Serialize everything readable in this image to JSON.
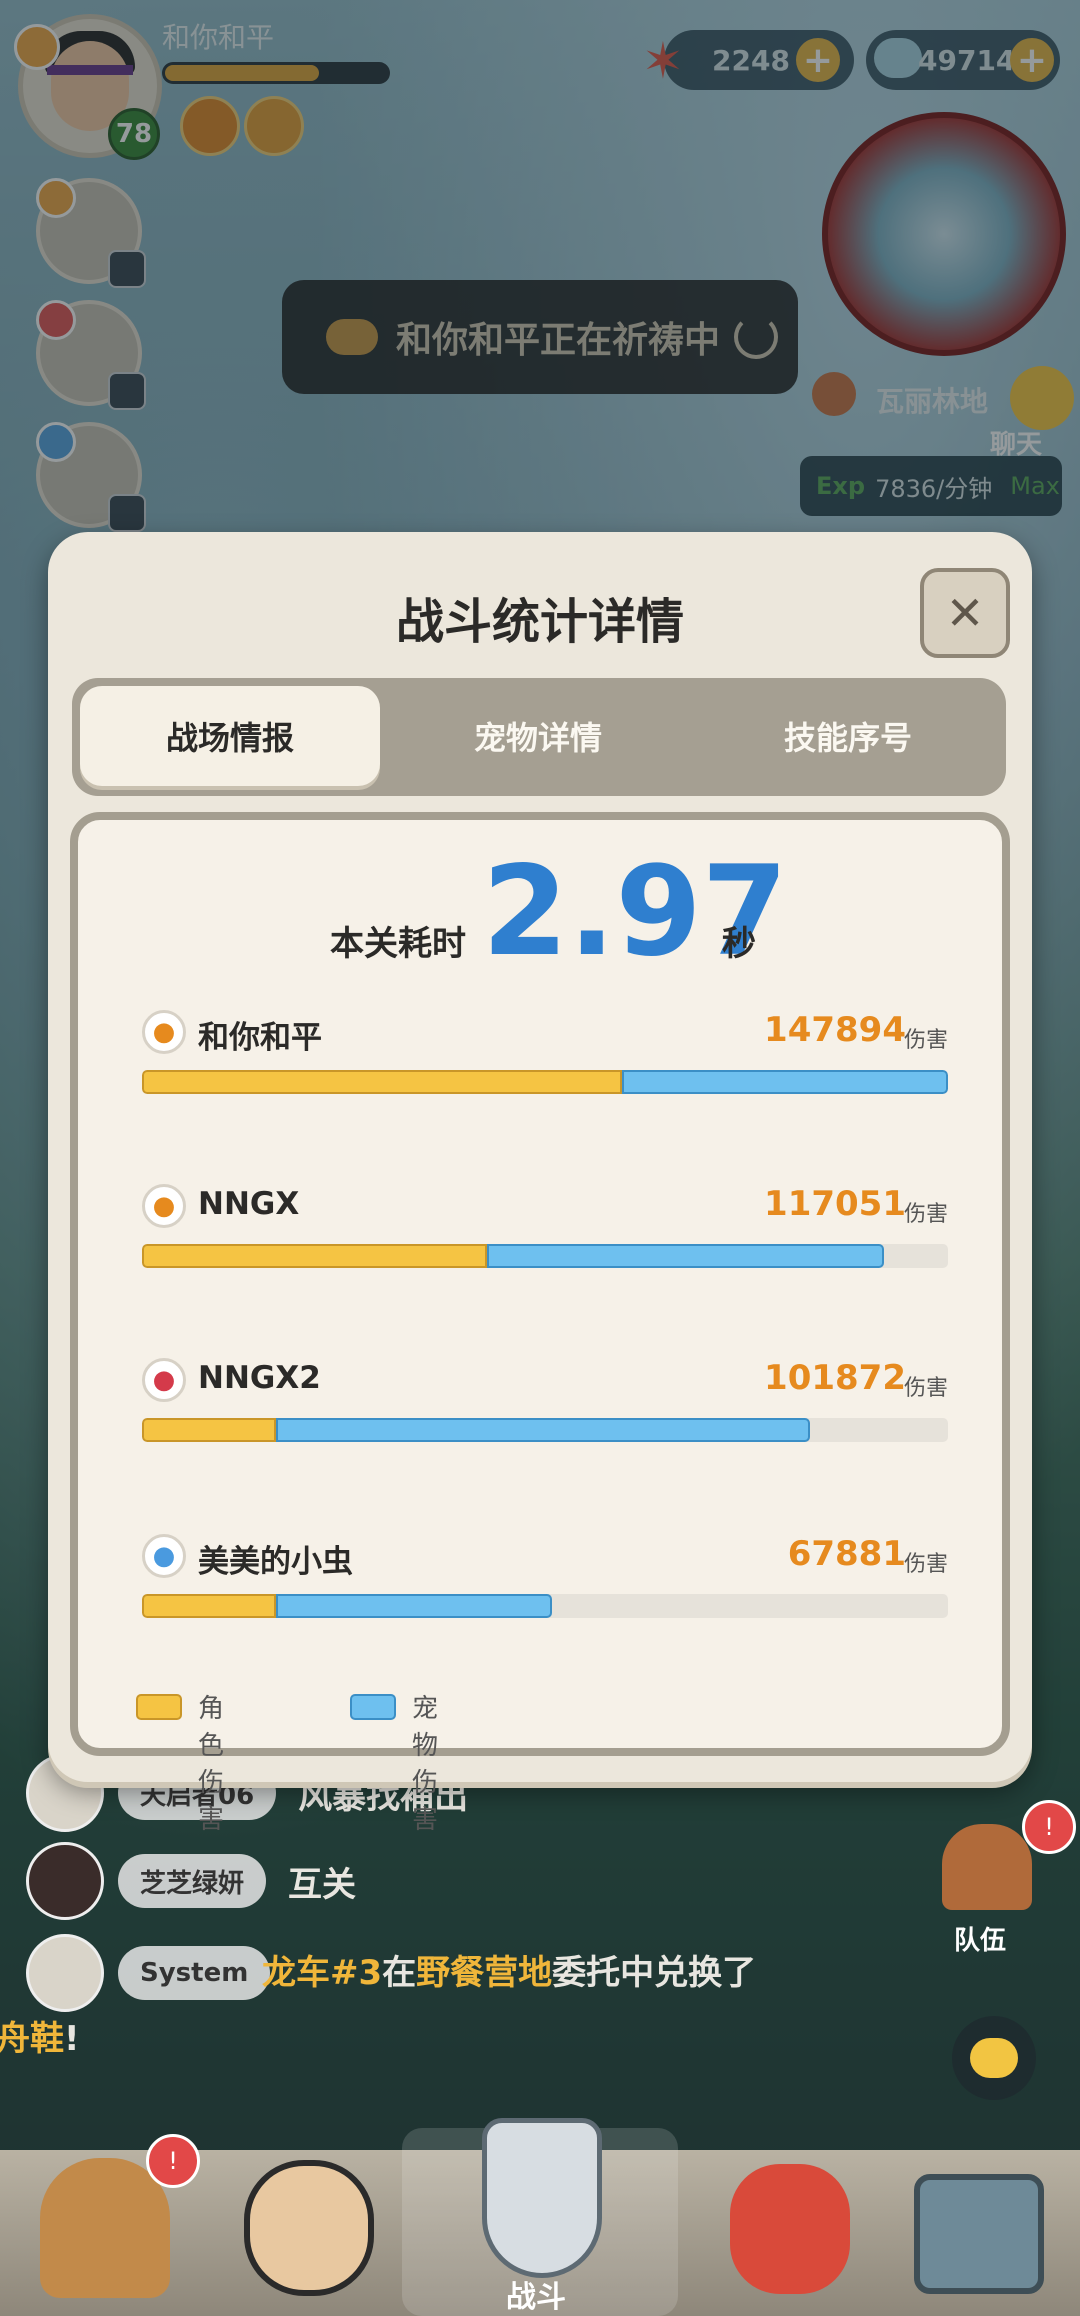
{
  "hud": {
    "player_name": "和你和平",
    "level": "78",
    "currency_star": "2248",
    "currency_shell": "497147",
    "pray_text": "和你和平正在祈祷中",
    "zone_name": "瓦丽林地",
    "chat_label": "聊天",
    "exp_label": "Exp",
    "exp_rate": "7836/分钟",
    "exp_max": "Max"
  },
  "modal": {
    "title": "战斗统计详情",
    "close": "✕",
    "tabs": [
      {
        "label": "战场情报",
        "active": true
      },
      {
        "label": "宠物详情",
        "active": false
      },
      {
        "label": "技能序号",
        "active": false
      }
    ],
    "time_label": "本关耗时",
    "time_value": "2.97",
    "time_unit": "秒",
    "damage_unit": "伤害",
    "legend": {
      "character": "角色伤害",
      "pet": "宠物伤害"
    },
    "colors": {
      "character": "#f5c443",
      "pet": "#6ec0ef",
      "damage": "#e68a1e",
      "time": "#2f7fcf"
    }
  },
  "chart_data": {
    "type": "bar",
    "orientation": "horizontal-stacked",
    "categories": [
      "和你和平",
      "NNGX",
      "NNGX2",
      "美美的小虫"
    ],
    "totals": [
      147894,
      117051,
      101872,
      67881
    ],
    "series": [
      {
        "name": "角色伤害",
        "fractions": [
          0.595,
          0.428,
          0.166,
          0.166
        ]
      },
      {
        "name": "宠物伤害",
        "fractions": [
          0.405,
          0.492,
          0.662,
          0.342
        ]
      }
    ],
    "row_icons": [
      "crossed-blades-icon",
      "flame-icon",
      "beast-icon",
      "swirl-icon"
    ]
  },
  "chat": [
    {
      "name": "天启者06",
      "msg": "风暴找補出"
    },
    {
      "name": "芝芝绿妍",
      "msg": "互关"
    },
    {
      "name": "System",
      "parts": [
        "龙车#3",
        "在",
        "野餐营地",
        "委托中兑换了",
        "龙舟鞋",
        "!"
      ]
    }
  ],
  "side": {
    "team_label": "队伍"
  },
  "nav": {
    "battle_label": "战斗",
    "bell": "!"
  }
}
